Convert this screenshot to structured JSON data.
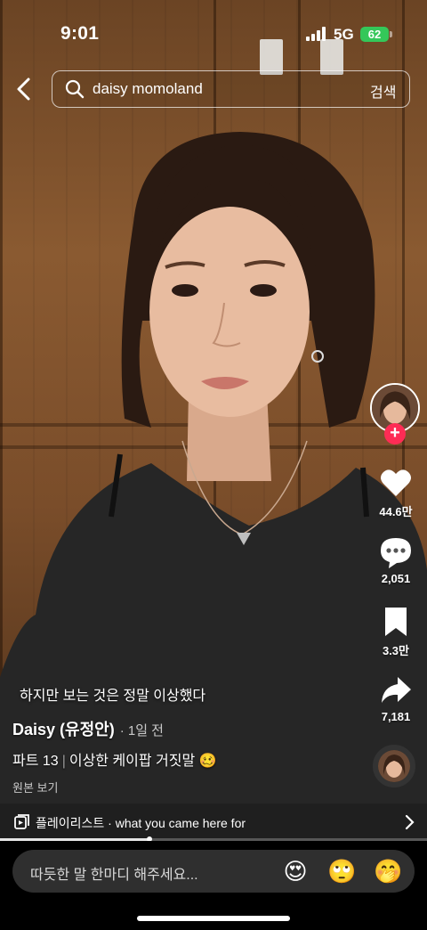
{
  "status": {
    "time": "9:01",
    "network": "5G",
    "battery": "62"
  },
  "search": {
    "query": "daisy momoland",
    "button_label": "검색"
  },
  "rail": {
    "likes": "44.6만",
    "comments": "2,051",
    "saves": "3.3만",
    "shares": "7,181",
    "follow_symbol": "+"
  },
  "video": {
    "subtitle": "하지만 보는 것은 정말 이상했다",
    "author": "Daisy (유정안)",
    "posted": "· 1일 전",
    "caption_part": "파트 13",
    "caption_sep": "|",
    "caption_text": "이상한 케이팝 거짓말",
    "caption_emoji": "🥴",
    "original_link": "원본 보기",
    "progress_percent": 35
  },
  "playlist": {
    "label": "플레이리스트 · what you came here for"
  },
  "comment_bar": {
    "placeholder": "따듯한 말 한마디 해주세요...",
    "emojis": [
      "😍",
      "🙄",
      "🤭"
    ]
  },
  "colors": {
    "follow": "#fe2c55",
    "battery": "#34c759"
  }
}
